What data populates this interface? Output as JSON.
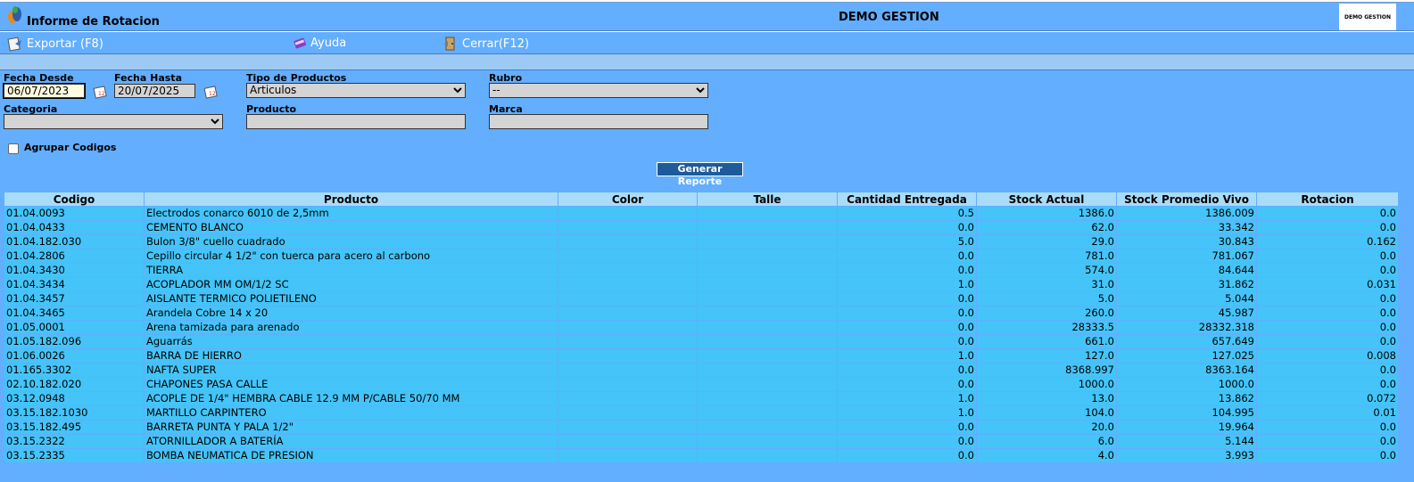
{
  "header": {
    "title": "Informe de Rotacion",
    "company": "DEMO GESTION",
    "brand_logo": "DEMO GESTION"
  },
  "menu": [
    {
      "label": "Exportar (F8)",
      "icon": "export-icon"
    },
    {
      "label": "Ayuda",
      "icon": "help-book-icon"
    },
    {
      "label": "Cerrar(F12)",
      "icon": "close-door-icon"
    }
  ],
  "filters": {
    "fecha_desde_label": "Fecha Desde",
    "fecha_desde_value": "06/07/2023",
    "fecha_hasta_label": "Fecha Hasta",
    "fecha_hasta_value": "20/07/2025",
    "tipo_label": "Tipo de Productos",
    "tipo_value": "Articulos",
    "rubro_label": "Rubro",
    "rubro_value": "--",
    "categoria_label": "Categoria",
    "categoria_value": "",
    "producto_label": "Producto",
    "producto_value": "",
    "marca_label": "Marca",
    "marca_value": "",
    "agrupar_label": "Agrupar Codigos",
    "generate_label": "Generar Reporte"
  },
  "table": {
    "columns": [
      "Codigo",
      "Producto",
      "Color",
      "Talle",
      "Cantidad Entregada",
      "Stock Actual",
      "Stock Promedio Vivo",
      "Rotacion"
    ],
    "rows": [
      [
        "01.04.0093",
        "Electrodos conarco 6010 de 2,5mm",
        "",
        "",
        "0.5",
        "1386.0",
        "1386.009",
        "0.0"
      ],
      [
        "01.04.0433",
        "CEMENTO BLANCO",
        "",
        "",
        "0.0",
        "62.0",
        "33.342",
        "0.0"
      ],
      [
        "01.04.182.030",
        "Bulon 3/8\" cuello cuadrado",
        "",
        "",
        "5.0",
        "29.0",
        "30.843",
        "0.162"
      ],
      [
        "01.04.2806",
        "Cepillo circular 4 1/2\" con tuerca para acero al carbono",
        "",
        "",
        "0.0",
        "781.0",
        "781.067",
        "0.0"
      ],
      [
        "01.04.3430",
        "TIERRA",
        "",
        "",
        "0.0",
        "574.0",
        "84.644",
        "0.0"
      ],
      [
        "01.04.3434",
        "ACOPLADOR MM OM/1/2 SC",
        "",
        "",
        "1.0",
        "31.0",
        "31.862",
        "0.031"
      ],
      [
        "01.04.3457",
        "AISLANTE TERMICO POLIETILENO",
        "",
        "",
        "0.0",
        "5.0",
        "5.044",
        "0.0"
      ],
      [
        "01.04.3465",
        "Arandela Cobre 14 x 20",
        "",
        "",
        "0.0",
        "260.0",
        "45.987",
        "0.0"
      ],
      [
        "01.05.0001",
        "Arena tamizada para arenado",
        "",
        "",
        "0.0",
        "28333.5",
        "28332.318",
        "0.0"
      ],
      [
        "01.05.182.096",
        "Aguarrás",
        "",
        "",
        "0.0",
        "661.0",
        "657.649",
        "0.0"
      ],
      [
        "01.06.0026",
        "BARRA DE HIERRO",
        "",
        "",
        "1.0",
        "127.0",
        "127.025",
        "0.008"
      ],
      [
        "01.165.3302",
        "NAFTA SUPER",
        "",
        "",
        "0.0",
        "8368.997",
        "8363.164",
        "0.0"
      ],
      [
        "02.10.182.020",
        "CHAPONES PASA CALLE",
        "",
        "",
        "0.0",
        "1000.0",
        "1000.0",
        "0.0"
      ],
      [
        "03.12.0948",
        "ACOPLE DE 1/4\" HEMBRA CABLE 12.9 MM P/CABLE 50/70 MM",
        "",
        "",
        "1.0",
        "13.0",
        "13.862",
        "0.072"
      ],
      [
        "03.15.182.1030",
        "MARTILLO CARPINTERO",
        "",
        "",
        "1.0",
        "104.0",
        "104.995",
        "0.01"
      ],
      [
        "03.15.182.495",
        "BARRETA PUNTA Y PALA 1/2\"",
        "",
        "",
        "0.0",
        "20.0",
        "19.964",
        "0.0"
      ],
      [
        "03.15.2322",
        "ATORNILLADOR A BATERÍA",
        "",
        "",
        "0.0",
        "6.0",
        "5.144",
        "0.0"
      ],
      [
        "03.15.2335",
        "BOMBA NEUMATICA DE PRESION",
        "",
        "",
        "0.0",
        "4.0",
        "3.993",
        "0.0"
      ]
    ]
  }
}
